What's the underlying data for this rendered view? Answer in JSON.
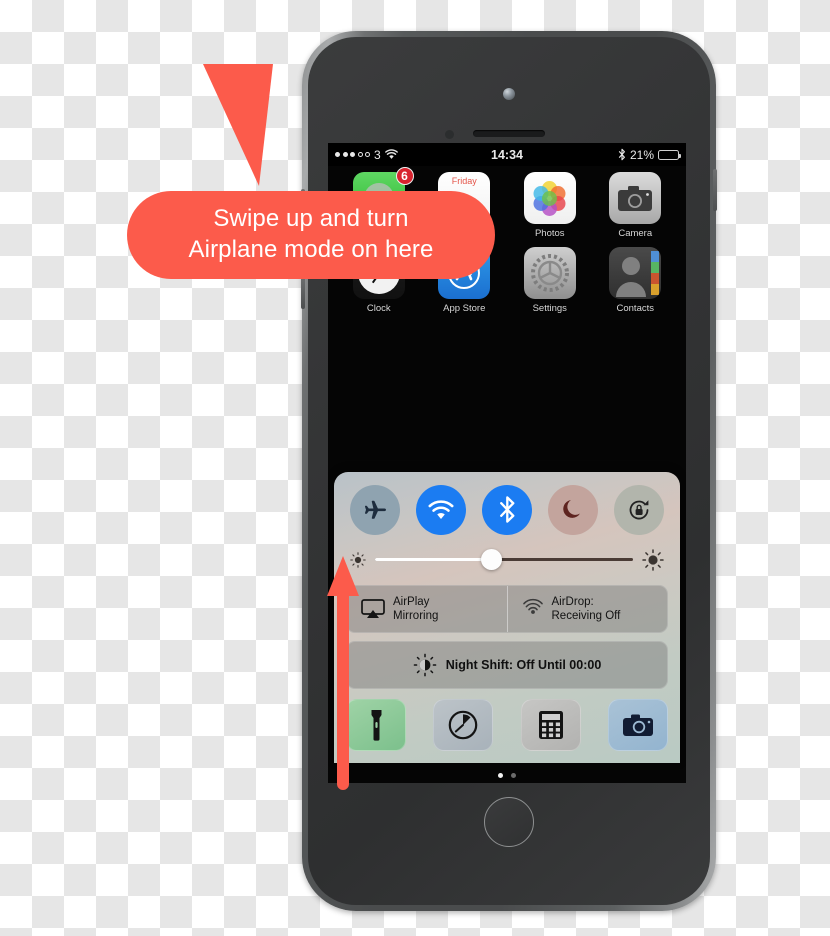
{
  "device": {
    "name": "iPhone 5s",
    "color_name": "space-gray",
    "body_color": "#4a4c4d",
    "bezel_color": "#343536"
  },
  "status_bar": {
    "signal_dots_total": 5,
    "signal_dots_filled": 3,
    "carrier": "3",
    "wifi_icon": "wifi-icon",
    "time": "14:34",
    "bluetooth_icon": "bluetooth-icon",
    "battery_percent_label": "21%",
    "battery_percent": 21
  },
  "home_screen": {
    "apps": [
      {
        "label": "",
        "icon": "phone-app-icon",
        "badge": "6"
      },
      {
        "label": "",
        "icon": "calendar-app-icon",
        "day": "Friday"
      },
      {
        "label": "Photos",
        "icon": "photos-app-icon",
        "badge": ""
      },
      {
        "label": "Camera",
        "icon": "camera-app-icon",
        "badge": ""
      },
      {
        "label": "Clock",
        "icon": "clock-app-icon",
        "badge": ""
      },
      {
        "label": "App Store",
        "icon": "app-store-app-icon",
        "badge": ""
      },
      {
        "label": "Settings",
        "icon": "settings-app-icon",
        "badge": ""
      },
      {
        "label": "Contacts",
        "icon": "contacts-app-icon",
        "badge": ""
      }
    ],
    "page_dots": {
      "count": 2,
      "active_index": 0
    }
  },
  "control_center": {
    "toggles": [
      {
        "name": "airplane-mode-toggle",
        "icon": "airplane-icon",
        "state": "off",
        "color": "#8fa3b0"
      },
      {
        "name": "wifi-toggle",
        "icon": "wifi-icon",
        "state": "on",
        "color": "#1b7cf2"
      },
      {
        "name": "bluetooth-toggle",
        "icon": "bluetooth-icon",
        "state": "on",
        "color": "#1b7cf2"
      },
      {
        "name": "do-not-disturb-toggle",
        "icon": "moon-icon",
        "state": "off",
        "color": "#c3a49d"
      },
      {
        "name": "rotation-lock-toggle",
        "icon": "rotation-lock-icon",
        "state": "off",
        "color": "#b2b5ac"
      }
    ],
    "brightness": {
      "value_percent": 45,
      "min_icon": "small-sun-icon",
      "max_icon": "large-sun-icon"
    },
    "airplay": {
      "line1": "AirPlay",
      "line2": "Mirroring",
      "icon": "airplay-icon"
    },
    "airdrop": {
      "line1": "AirDrop:",
      "line2": "Receiving Off",
      "icon": "airdrop-icon"
    },
    "night_shift": {
      "label": "Night Shift: Off Until 00:00",
      "icon": "night-shift-icon"
    },
    "shortcuts": [
      {
        "name": "flashlight-shortcut",
        "icon": "flashlight-icon",
        "color": "#8ecb97"
      },
      {
        "name": "timer-shortcut",
        "icon": "timer-icon",
        "color": "#b0b9c0"
      },
      {
        "name": "calculator-shortcut",
        "icon": "calculator-icon",
        "color": "#bcbcba"
      },
      {
        "name": "camera-shortcut",
        "icon": "camera-icon",
        "color": "#9dbad3"
      }
    ]
  },
  "annotations": {
    "callout": {
      "line1": "Swipe up and turn",
      "line2": "Airplane mode on here",
      "color": "#fc5b4b"
    },
    "swipe_arrow": {
      "direction": "up",
      "color": "#fc5b4b"
    }
  }
}
